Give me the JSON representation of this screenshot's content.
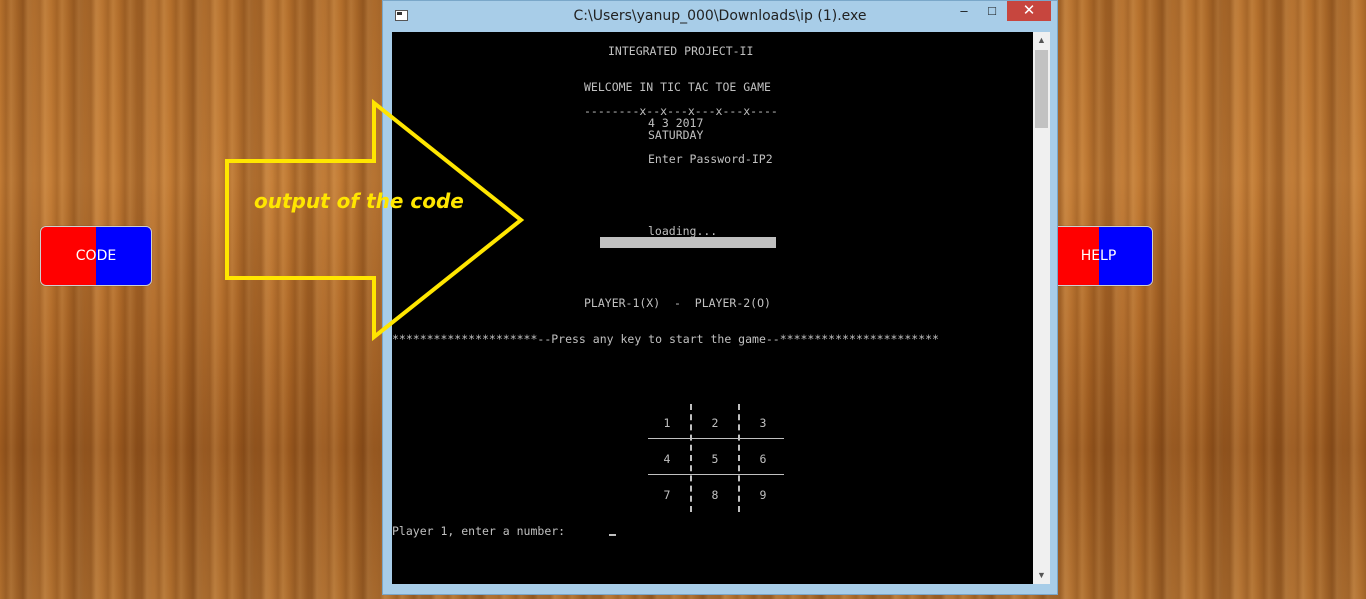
{
  "left_button": {
    "label": "CODE"
  },
  "right_button": {
    "label": "HELP"
  },
  "annotation": {
    "text": "output of the code",
    "color": "#ffe600"
  },
  "window": {
    "title": "C:\\Users\\yanup_000\\Downloads\\ip (1).exe",
    "min_glyph": "–",
    "max_glyph": "□",
    "close_glyph": "✕"
  },
  "console": {
    "project_title": "INTEGRATED PROJECT-II",
    "welcome": "WELCOME IN TIC TAC TOE GAME",
    "divider": "--------x--x---x---x---x----",
    "date": "4 3 2017",
    "day": "SATURDAY",
    "password": "Enter Password-IP2",
    "loading": "loading...",
    "players": "PLAYER-1(X)  -  PLAYER-2(O)",
    "press_key": "*********************--Press any key to start the game--***********************",
    "board": [
      "1",
      "2",
      "3",
      "4",
      "5",
      "6",
      "7",
      "8",
      "9"
    ],
    "prompt": "Player 1, enter a number:"
  },
  "colors": {
    "code_left": "#ff0000",
    "code_right": "#0000ff",
    "console_bg": "#000000",
    "console_fg": "#c0c0c0"
  }
}
